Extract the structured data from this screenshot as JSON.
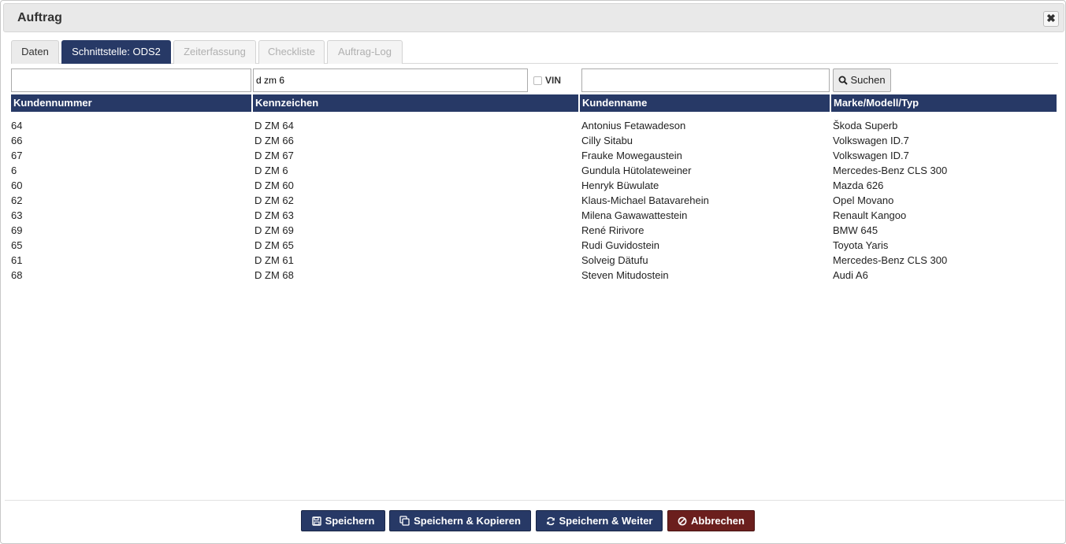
{
  "dialog": {
    "title": "Auftrag",
    "close_icon": "close-icon"
  },
  "tabs": [
    {
      "label": "Daten",
      "state": "normal"
    },
    {
      "label": "Schnittstelle: ODS2",
      "state": "active"
    },
    {
      "label": "Zeiterfassung",
      "state": "disabled"
    },
    {
      "label": "Checkliste",
      "state": "disabled"
    },
    {
      "label": "Auftrag-Log",
      "state": "disabled"
    }
  ],
  "search": {
    "customer_number_value": "",
    "plate_value": "d zm 6",
    "vin_label": "VIN",
    "vin_checked": false,
    "name_value": "",
    "button_label": "Suchen",
    "button_icon": "search-icon"
  },
  "table": {
    "headers": [
      "Kundennummer",
      "Kennzeichen",
      "Kundenname",
      "Marke/Modell/Typ"
    ],
    "rows": [
      [
        "64",
        "D ZM 64",
        "Antonius Fetawadeson",
        "Škoda Superb"
      ],
      [
        "66",
        "D ZM 66",
        "Cilly Sitabu",
        "Volkswagen ID.7"
      ],
      [
        "67",
        "D ZM 67",
        "Frauke Mowegaustein",
        "Volkswagen ID.7"
      ],
      [
        "6",
        "D ZM 6",
        "Gundula Hütolateweiner",
        "Mercedes-Benz CLS 300"
      ],
      [
        "60",
        "D ZM 60",
        "Henryk Büwulate",
        "Mazda 626"
      ],
      [
        "62",
        "D ZM 62",
        "Klaus-Michael Batavarehein",
        "Opel Movano"
      ],
      [
        "63",
        "D ZM 63",
        "Milena Gawawattestein",
        "Renault Kangoo"
      ],
      [
        "69",
        "D ZM 69",
        "René Ririvore",
        "BMW 645"
      ],
      [
        "65",
        "D ZM 65",
        "Rudi Guvidostein",
        "Toyota Yaris"
      ],
      [
        "61",
        "D ZM 61",
        "Solveig Dätufu",
        "Mercedes-Benz CLS 300"
      ],
      [
        "68",
        "D ZM 68",
        "Steven Mitudostein",
        "Audi A6"
      ]
    ]
  },
  "footer": {
    "save_label": "Speichern",
    "save_copy_label": "Speichern & Kopieren",
    "save_next_label": "Speichern & Weiter",
    "cancel_label": "Abbrechen"
  },
  "colors": {
    "primary": "#273966",
    "cancel": "#6b1f1d"
  }
}
